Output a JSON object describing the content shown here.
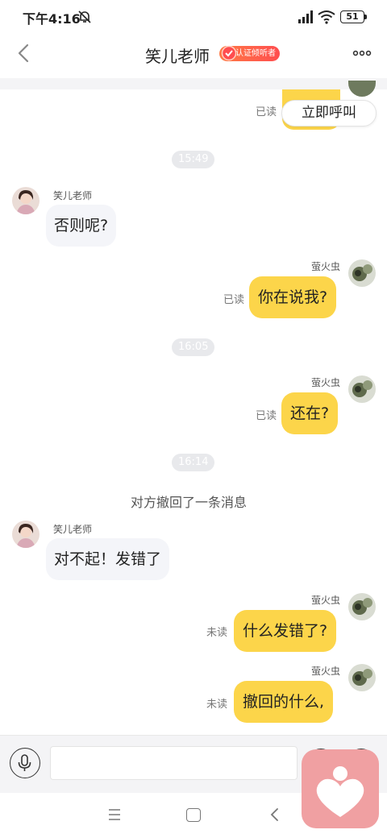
{
  "status_bar": {
    "time": "下午4:16",
    "battery": "51"
  },
  "header": {
    "title": "笑儿老师",
    "badge": "认证倾听者"
  },
  "call_button": {
    "label": "立即呼叫"
  },
  "messages": {
    "m0_read": "已读",
    "t1": "15:49",
    "m1_sender": "笑儿老师",
    "m1_text": "否则呢?",
    "m2_sender": "萤火虫",
    "m2_text": "你在说我?",
    "m2_read": "已读",
    "t2": "16:05",
    "m3_sender": "萤火虫",
    "m3_text": "还在?",
    "m3_read": "已读",
    "t3": "16:14",
    "recall": "对方撤回了一条消息",
    "m4_sender": "笑儿老师",
    "m4_text": "对不起！发错了",
    "m5_sender": "萤火虫",
    "m5_text": "什么发错了?",
    "m5_read": "未读",
    "m6_sender": "萤火虫",
    "m6_text": "撤回的什么,",
    "m6_read": "未读"
  },
  "colors": {
    "bubble_self": "#fcd54a",
    "bubble_other": "#f4f5f9",
    "badge": "#ff4d4f",
    "logo": "#f0a0a2"
  },
  "icons": [
    "back-icon",
    "more-icon",
    "bell-off-icon",
    "signal-icon",
    "wifi-icon",
    "mic-icon",
    "heart-logo-icon"
  ]
}
